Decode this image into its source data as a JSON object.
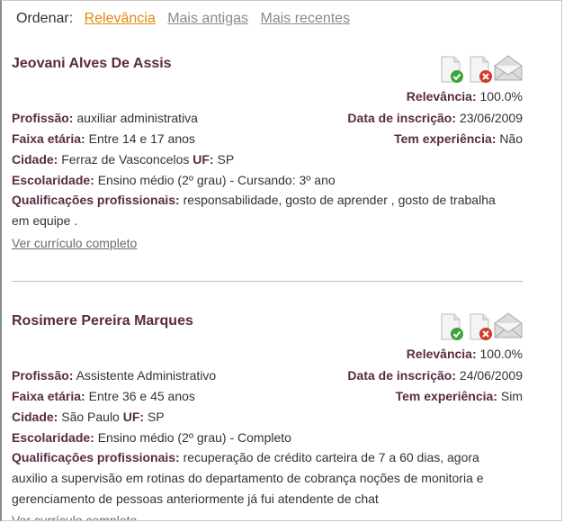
{
  "sort": {
    "label": "Ordenar:",
    "options": [
      "Relevância",
      "Mais antigas",
      "Mais recentes"
    ]
  },
  "labels": {
    "relevance": "Relevância:",
    "profession": "Profissão:",
    "registration": "Data de inscrição:",
    "age": "Faixa etária:",
    "experience": "Tem experiência:",
    "city": "Cidade:",
    "state": "UF:",
    "education": "Escolaridade:",
    "qualifications": "Qualificações profissionais:",
    "view_link": "Ver currículo completo"
  },
  "candidates": [
    {
      "name": "Jeovani Alves De Assis",
      "relevance": "100.0%",
      "profession": "auxiliar administrativa",
      "registration": "23/06/2009",
      "age": "Entre 14 e 17 anos",
      "experience": "Não",
      "city": "Ferraz de Vasconcelos",
      "state": "SP",
      "education": "Ensino médio (2º grau) - Cursando: 3º ano",
      "qualifications": "responsabilidade, gosto de aprender , gosto de trabalha em equipe ."
    },
    {
      "name": "Rosimere Pereira Marques",
      "relevance": "100.0%",
      "profession": "Assistente Administrativo",
      "registration": "24/06/2009",
      "age": "Entre 36 e 45 anos",
      "experience": "Sim",
      "city": "São Paulo",
      "state": "SP",
      "education": "Ensino médio (2º grau) - Completo",
      "qualifications": "recuperação de crédito carteira de 7 a 60 dias, agora auxilio a supervisão em rotinas do departamento de cobrança noções de monitoria e gerenciamento de pessoas anteriormente já fui atendente de chat"
    }
  ],
  "colors": {
    "accent": "#e08a10",
    "label": "#5a2a44",
    "muted": "#8a8a8a",
    "approve": "#3aa63a",
    "reject": "#d43a2a"
  },
  "icons": [
    "approve-doc-icon",
    "reject-doc-icon",
    "mail-icon"
  ]
}
